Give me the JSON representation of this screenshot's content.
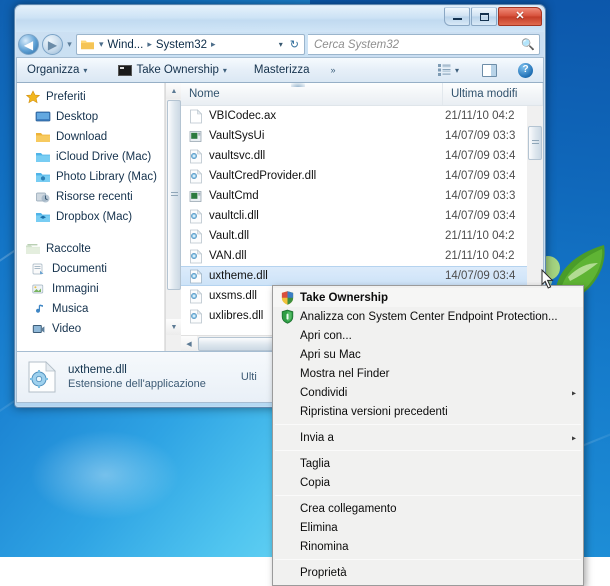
{
  "window": {
    "title_buttons": {
      "minimize": "Riduci a icona",
      "maximize": "Ingrandisci",
      "close": "Chiudi",
      "close_glyph": "✕"
    },
    "nav": {
      "back": "◀",
      "forward": "▶",
      "back_tooltip": "Indietro",
      "forward_tooltip": "Avanti"
    },
    "breadcrumb": {
      "separator": "▸",
      "items": [
        "Wind...",
        "System32"
      ],
      "leading_sep": "▾",
      "dropdown_glyph": "▾",
      "refresh_glyph": "↻"
    },
    "search": {
      "placeholder": "Cerca System32",
      "value": "",
      "icon": "search-icon",
      "glyph": "🔍"
    }
  },
  "toolbar": {
    "organize": "Organizza",
    "take_ownership": "Take Ownership",
    "burn": "Masterizza",
    "overflow": "»",
    "caret": "▾",
    "view_label": "Cambia visualizzazione",
    "preview_label": "Mostra riquadro anteprima",
    "help_label": "?"
  },
  "navpane": {
    "groups": [
      {
        "root": {
          "label": "Preferiti",
          "icon": "star-icon"
        },
        "items": [
          {
            "label": "Desktop",
            "icon": "desktop-icon"
          },
          {
            "label": "Download",
            "icon": "folder-icon"
          },
          {
            "label": "iCloud Drive (Mac)",
            "icon": "cloud-folder-icon"
          },
          {
            "label": "Photo Library (Mac)",
            "icon": "photo-folder-icon"
          },
          {
            "label": "Risorse recenti",
            "icon": "recent-places-icon"
          },
          {
            "label": "Dropbox (Mac)",
            "icon": "dropbox-folder-icon"
          }
        ]
      },
      {
        "root": {
          "label": "Raccolte",
          "icon": "libraries-icon"
        },
        "items": [
          {
            "label": "Documenti",
            "icon": "documents-library-icon"
          },
          {
            "label": "Immagini",
            "icon": "pictures-library-icon"
          },
          {
            "label": "Musica",
            "icon": "music-library-icon"
          },
          {
            "label": "Video",
            "icon": "video-library-icon"
          }
        ]
      }
    ]
  },
  "filelist": {
    "columns": [
      "Nome",
      "Ultima modifi"
    ],
    "rows": [
      {
        "name": "VBICodec.ax",
        "modified": "21/11/10 04:2",
        "icon": "generic-file-icon",
        "selected": false
      },
      {
        "name": "VaultSysUi",
        "modified": "14/07/09 03:3",
        "icon": "console-app-icon",
        "selected": false
      },
      {
        "name": "vaultsvc.dll",
        "modified": "14/07/09 03:4",
        "icon": "dll-file-icon",
        "selected": false
      },
      {
        "name": "VaultCredProvider.dll",
        "modified": "14/07/09 03:4",
        "icon": "dll-file-icon",
        "selected": false
      },
      {
        "name": "VaultCmd",
        "modified": "14/07/09 03:3",
        "icon": "console-app-icon",
        "selected": false
      },
      {
        "name": "vaultcli.dll",
        "modified": "14/07/09 03:4",
        "icon": "dll-file-icon",
        "selected": false
      },
      {
        "name": "Vault.dll",
        "modified": "21/11/10 04:2",
        "icon": "dll-file-icon",
        "selected": false
      },
      {
        "name": "VAN.dll",
        "modified": "21/11/10 04:2",
        "icon": "dll-file-icon",
        "selected": false
      },
      {
        "name": "uxtheme.dll",
        "modified": "14/07/09 03:4",
        "icon": "dll-file-icon",
        "selected": true
      },
      {
        "name": "uxsms.dll",
        "modified": "",
        "icon": "dll-file-icon",
        "selected": false
      },
      {
        "name": "uxlibres.dll",
        "modified": "",
        "icon": "dll-file-icon",
        "selected": false
      }
    ]
  },
  "details_pane": {
    "file_name": "uxtheme.dll",
    "file_type": "Estensione dell'applicazione",
    "right_label": "Ulti",
    "icon": "dll-large-icon"
  },
  "context_menu": {
    "items": [
      {
        "label": "Take Ownership",
        "icon": "uac-shield-icon",
        "bold": true,
        "submenu": false,
        "separator_after": false
      },
      {
        "label": "Analizza con System Center Endpoint Protection...",
        "icon": "endpoint-protection-icon",
        "bold": false,
        "submenu": false,
        "separator_after": false
      },
      {
        "label": "Apri con...",
        "icon": null,
        "bold": false,
        "submenu": false,
        "separator_after": false
      },
      {
        "label": "Apri su Mac",
        "icon": null,
        "bold": false,
        "submenu": false,
        "separator_after": false
      },
      {
        "label": "Mostra nel Finder",
        "icon": null,
        "bold": false,
        "submenu": false,
        "separator_after": false
      },
      {
        "label": "Condividi",
        "icon": null,
        "bold": false,
        "submenu": true,
        "separator_after": false
      },
      {
        "label": "Ripristina versioni precedenti",
        "icon": null,
        "bold": false,
        "submenu": false,
        "separator_after": true
      },
      {
        "label": "Invia a",
        "icon": null,
        "bold": false,
        "submenu": true,
        "separator_after": true
      },
      {
        "label": "Taglia",
        "icon": null,
        "bold": false,
        "submenu": false,
        "separator_after": false
      },
      {
        "label": "Copia",
        "icon": null,
        "bold": false,
        "submenu": false,
        "separator_after": true
      },
      {
        "label": "Crea collegamento",
        "icon": null,
        "bold": false,
        "submenu": false,
        "separator_after": false
      },
      {
        "label": "Elimina",
        "icon": null,
        "bold": false,
        "submenu": false,
        "separator_after": false
      },
      {
        "label": "Rinomina",
        "icon": null,
        "bold": false,
        "submenu": false,
        "separator_after": true
      },
      {
        "label": "Proprietà",
        "icon": null,
        "bold": false,
        "submenu": false,
        "separator_after": false
      }
    ],
    "submenu_arrow": "▸"
  },
  "colors": {
    "accent": "#1f6fb5",
    "selection": "#cde3f8",
    "close_button": "#c43c27",
    "desktop_top": "#0f5fb0",
    "desktop_bottom": "#8ee6f8",
    "menu_bg": "#f1f1f0"
  }
}
